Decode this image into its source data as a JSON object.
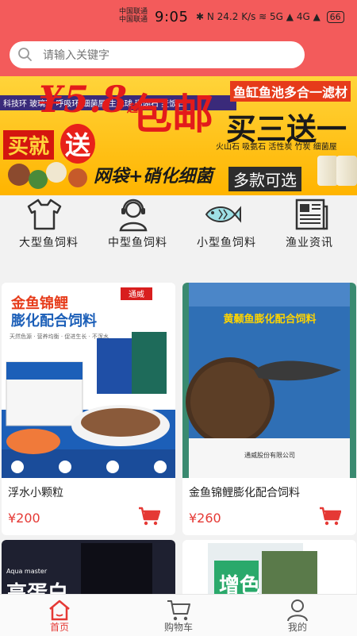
{
  "status_bar": {
    "carrier_1": "中国联通",
    "carrier_2": "中国联通",
    "time": "9:05",
    "icons": "✱ N 24.2 K/s ≋ 5G ▲ 4G ▲",
    "battery": "66"
  },
  "search": {
    "placeholder": "请输入关键字"
  },
  "banner": {
    "price": "¥5.8",
    "price_suffix": "起",
    "free_shipping": "包邮",
    "right_title": "鱼缸鱼池多合一滤材",
    "buy3": "买三送一",
    "tags": "科技环 玻璃环 呼吸环 细菌屋 生化球 珊瑚石 麦饭石",
    "tags2": "火山石 吸氨石 活性炭 竹炭 细菌屋",
    "buy_now": "买就",
    "gift": "送",
    "gift_text": "网袋+硝化细菌",
    "variety": "多款可选"
  },
  "categories": [
    {
      "label": "大型鱼饲料",
      "icon": "shirt-icon"
    },
    {
      "label": "中型鱼饲料",
      "icon": "headset-person-icon"
    },
    {
      "label": "小型鱼饲料",
      "icon": "fish-icon"
    },
    {
      "label": "渔业资讯",
      "icon": "newspaper-icon"
    }
  ],
  "products": [
    {
      "title": "浮水小颗粒",
      "price": "¥200",
      "image_brand": "通威",
      "image_title": "金鱼锦鲤",
      "image_subtitle": "膨化配合饲料",
      "image_features": "天然色源 · 营养均衡 · 促进生长 · 不浑水"
    },
    {
      "title": "金鱼锦鲤膨化配合饲料",
      "price": "¥260",
      "image_title": "黄颡鱼膨化配合饲料",
      "image_company": "通威股份有限公司"
    }
  ],
  "products_partial": [
    {
      "image_brand": "Aqua master",
      "image_text": "高蛋白"
    },
    {
      "image_text": "增色"
    }
  ],
  "tabs": [
    {
      "label": "首页",
      "icon": "home-icon",
      "active": true
    },
    {
      "label": "购物车",
      "icon": "cart-icon",
      "active": false
    },
    {
      "label": "我的",
      "icon": "user-icon",
      "active": false
    }
  ],
  "colors": {
    "header": "#f35b5b",
    "accent": "#e53935",
    "banner_yellow": "#ffc61a"
  }
}
